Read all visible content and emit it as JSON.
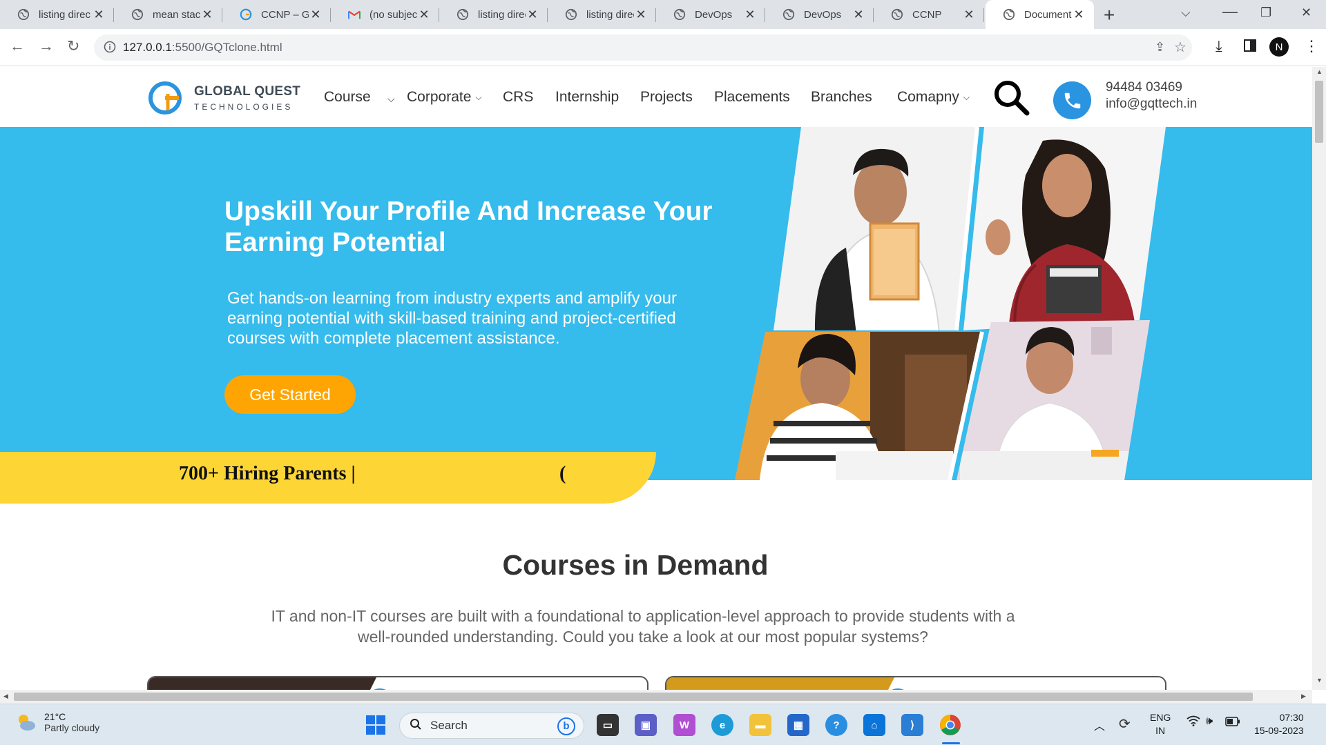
{
  "browser": {
    "tabs": [
      {
        "title": "listing direc",
        "icon": "globe-icon"
      },
      {
        "title": "mean stack",
        "icon": "globe-icon"
      },
      {
        "title": "CCNP – Glo",
        "icon": "gqt-favicon-icon"
      },
      {
        "title": "(no subject)",
        "icon": "gmail-icon"
      },
      {
        "title": "listing direc",
        "icon": "globe-icon"
      },
      {
        "title": "listing direc",
        "icon": "globe-icon"
      },
      {
        "title": "DevOps",
        "icon": "globe-icon"
      },
      {
        "title": "DevOps",
        "icon": "globe-icon"
      },
      {
        "title": "CCNP",
        "icon": "globe-icon"
      },
      {
        "title": "Document",
        "icon": "globe-icon",
        "active": true
      }
    ],
    "url_host": "127.0.0.1",
    "url_path": ":5500/GQTclone.html",
    "profile_initial": "N"
  },
  "site": {
    "logo": {
      "line1": "GLOBAL QUEST",
      "line2": "TECHNOLOGIES"
    },
    "menu": [
      {
        "label": "Course",
        "chevron": false
      },
      {
        "label": "Corporate",
        "chevron": true
      },
      {
        "label": "CRS",
        "chevron": false
      },
      {
        "label": "Internship",
        "chevron": false
      },
      {
        "label": "Projects",
        "chevron": false
      },
      {
        "label": "Placements",
        "chevron": false
      },
      {
        "label": "Branches",
        "chevron": false
      },
      {
        "label": "Comapny",
        "chevron": true
      }
    ],
    "contact": {
      "phone": "94484 03469",
      "email": "info@gqttech.in"
    },
    "hero": {
      "title": "Upskill Your Profile And Increase Your Earning Potential",
      "text": "Get hands-on learning from industry experts and amplify your earning potential with skill-based training and project-certified courses with complete placement assistance.",
      "cta": "Get Started",
      "hiring": "700+ Hiring Parents |",
      "hiring_glyph": "("
    },
    "courses": {
      "title": "Courses in Demand",
      "description": "IT and non-IT courses are built with a foundational to application-level approach to provide students with a well-rounded understanding. Could you take a look at our most popular systems?"
    }
  },
  "taskbar": {
    "weather": {
      "temp": "21°C",
      "condition": "Partly cloudy"
    },
    "search_placeholder": "Search",
    "language": {
      "line1": "ENG",
      "line2": "IN"
    },
    "clock": {
      "time": "07:30",
      "date": "15-09-2023"
    }
  },
  "colors": {
    "hero_bg": "#35bbec",
    "cta_bg": "#fea503",
    "hiring_band": "#fdd535",
    "phone_circle": "#2b94e0"
  }
}
